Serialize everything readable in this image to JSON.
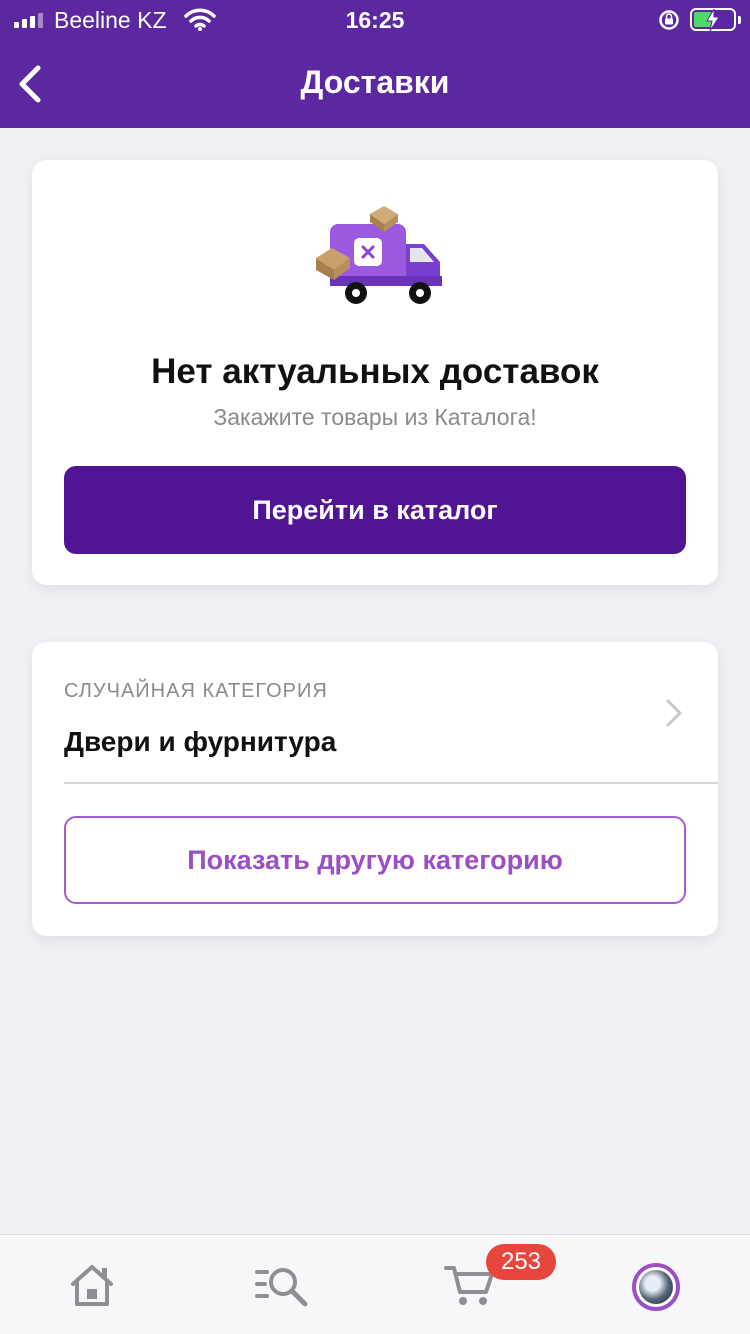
{
  "status_bar": {
    "carrier": "Beeline KZ",
    "time": "16:25"
  },
  "header": {
    "title": "Доставки"
  },
  "empty_state": {
    "title": "Нет актуальных доставок",
    "subtitle": "Закажите товары из Каталога!",
    "button_label": "Перейти в каталог"
  },
  "random_category": {
    "label": "СЛУЧАЙНАЯ КАТЕГОРИЯ",
    "name": "Двери и фурнитура",
    "button_label": "Показать другую категорию"
  },
  "tabbar": {
    "cart_badge": "253"
  },
  "colors": {
    "header_bg": "#5b28a0",
    "primary_button": "#511594",
    "outline_accent": "#9a4fc4",
    "badge": "#e8453c"
  }
}
